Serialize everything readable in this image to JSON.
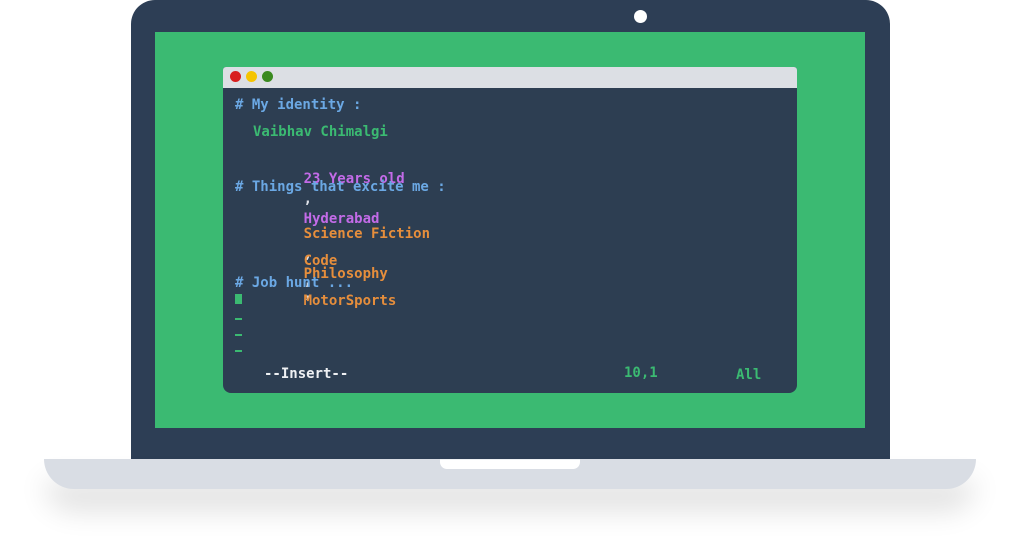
{
  "colors": {
    "lid": "#2d3e55",
    "screen": "#3bba72",
    "terminal_bg": "#2d3e52",
    "titlebar": "#dcdfe4",
    "heading": "#6ba8e4",
    "name": "#3bba72",
    "personal": "#c36be8",
    "interest": "#e68e3c",
    "dot_close": "#d81e1e",
    "dot_minimize": "#f5c400",
    "dot_maximize": "#3a8a1f"
  },
  "terminal": {
    "identity_heading": "# My identity :",
    "name": "Vaibhav Chimalgi",
    "age": "23 Years old",
    "separator": ",",
    "city": "Hyderabad",
    "interests_heading": "# Things that excite me :",
    "interests": [
      "Science Fiction",
      "Philosophy",
      "Code",
      "MotorSports"
    ],
    "job_heading": "# Job hunt ..."
  },
  "status_bar": {
    "mode": "--Insert--",
    "position": "10,1",
    "scroll": "All"
  }
}
